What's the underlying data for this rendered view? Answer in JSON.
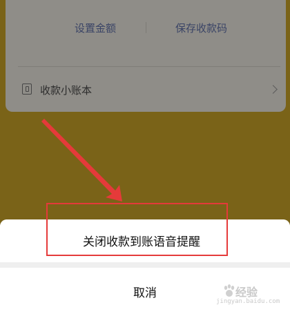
{
  "card": {
    "set_amount_label": "设置金额",
    "save_code_label": "保存收款码",
    "ledger_label": "收款小账本"
  },
  "sheet": {
    "option_label": "关闭收款到账语音提醒",
    "cancel_label": "取消"
  },
  "watermark": {
    "brand_text": "经验",
    "url_text": "jingyan.baidu.com"
  },
  "colors": {
    "overlay": "#7a6318",
    "annotation": "#e53a3a"
  }
}
